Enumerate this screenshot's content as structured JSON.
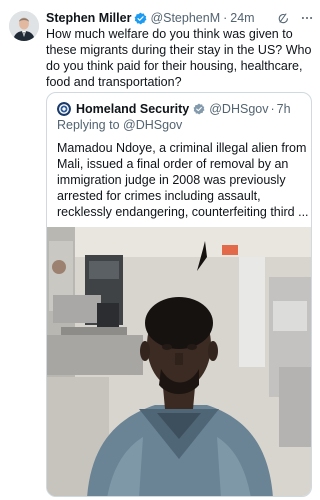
{
  "tweet": {
    "author_name": "Stephen Miller",
    "author_handle": "@StephenM",
    "separator": "·",
    "time": "24m",
    "text": "How much welfare do you think was given to these migrants during their stay in the US? Who do you think paid for their housing, healthcare, food and transportation?"
  },
  "quote": {
    "author_name": "Homeland Security",
    "author_handle": "@DHSgov",
    "separator": "·",
    "time": "7h",
    "reply_prefix": "Replying to",
    "reply_to": "@DHSgov",
    "text": "Mamadou Ndoye, a criminal illegal alien from Mali, issued a final order of removal by an immigration judge in 2008 was previously arrested for crimes including assault, recklessly endangering, counterfeiting third ..."
  },
  "icons": {
    "verified": "verified-badge-icon",
    "grok": "grok-icon",
    "gov": "government-badge-icon",
    "verified_color": "#1d9bf0",
    "gov_color": "#829aab"
  }
}
